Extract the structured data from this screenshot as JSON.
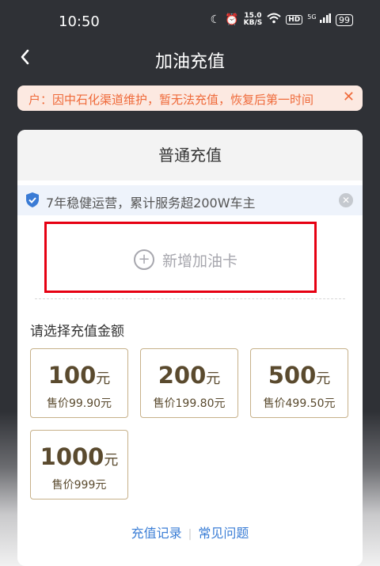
{
  "status_bar": {
    "time": "10:50",
    "speed_value": "15.0",
    "speed_unit": "KB/S",
    "hd": "HD",
    "signal": "5G",
    "battery": "99"
  },
  "header": {
    "title": "加油充值"
  },
  "notice": {
    "text": "户：因中石化渠道维护，暂无法充值，恢复后第一时间"
  },
  "card": {
    "title": "普通充值",
    "banner_text": "7年稳健运营，累计服务超200W车主",
    "add_card_label": "新增加油卡",
    "amount_section_label": "请选择充值金额",
    "options": [
      {
        "amount": "100",
        "unit": "元",
        "price": "售价99.90元"
      },
      {
        "amount": "200",
        "unit": "元",
        "price": "售价199.80元"
      },
      {
        "amount": "500",
        "unit": "元",
        "price": "售价499.50元"
      },
      {
        "amount": "1000",
        "unit": "元",
        "price": "售价999元"
      }
    ],
    "links": {
      "history": "充值记录",
      "faq": "常见问题"
    }
  },
  "colors": {
    "accent_link": "#3b7ed6",
    "notice_text": "#ef6a3a",
    "highlight_border": "#e60012",
    "option_border": "#c7b18a"
  }
}
